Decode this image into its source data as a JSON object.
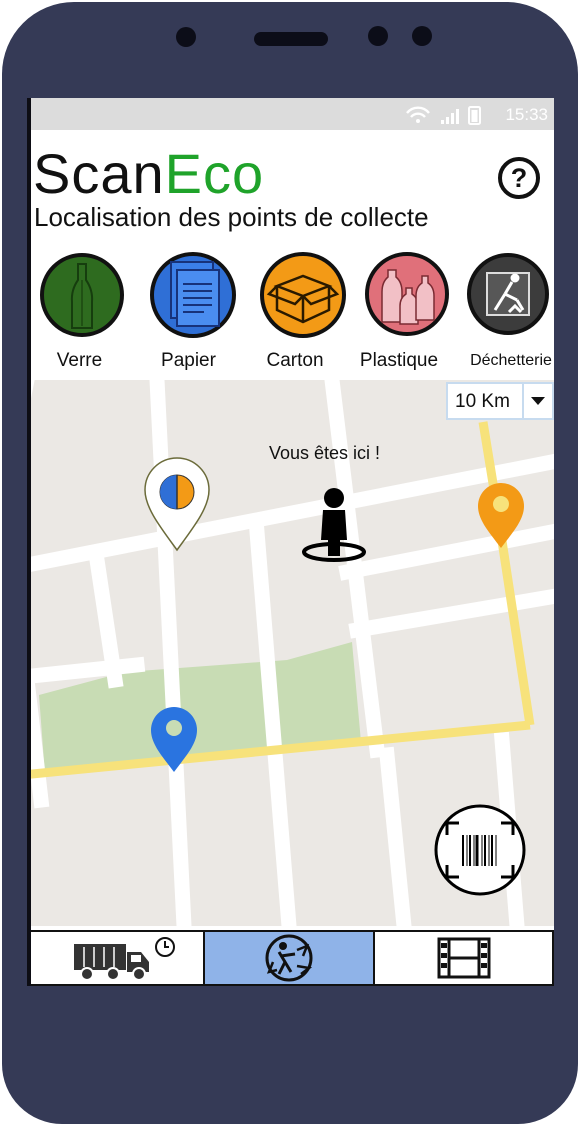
{
  "status_bar": {
    "time": "15:33",
    "icons": [
      "wifi-icon",
      "signal-icon",
      "battery-icon"
    ]
  },
  "app": {
    "logo_part1": "Scan",
    "logo_part2": "Eco",
    "subtitle": "Localisation des points de collecte"
  },
  "categories": [
    {
      "label": "Verre",
      "icon": "glass-bottle-icon",
      "color": "#2e6b1f"
    },
    {
      "label": "Papier",
      "icon": "paper-document-icon",
      "color": "#2f6fd6"
    },
    {
      "label": "Carton",
      "icon": "cardboard-box-icon",
      "color": "#f39a16"
    },
    {
      "label": "Plastique",
      "icon": "plastic-bottles-icon",
      "color": "#e0707a"
    },
    {
      "label": "Déchetterie",
      "icon": "recycling-center-icon",
      "color": "#3c3c3c"
    }
  ],
  "map": {
    "distance_filter": "10 Km",
    "user_label": "Vous êtes ici !",
    "markers": [
      "multi-category-marker",
      "orange-marker",
      "blue-marker"
    ]
  },
  "bottom_nav": {
    "tabs": [
      "truck-schedule-tab",
      "recycling-tab",
      "video-tab"
    ],
    "active": "recycling-tab"
  },
  "colors": {
    "phone": "#353a56",
    "green_logo": "#1fa32a",
    "active_tab": "#8fb3e8",
    "road": "#f7e27b",
    "park": "#c8dcb4"
  }
}
